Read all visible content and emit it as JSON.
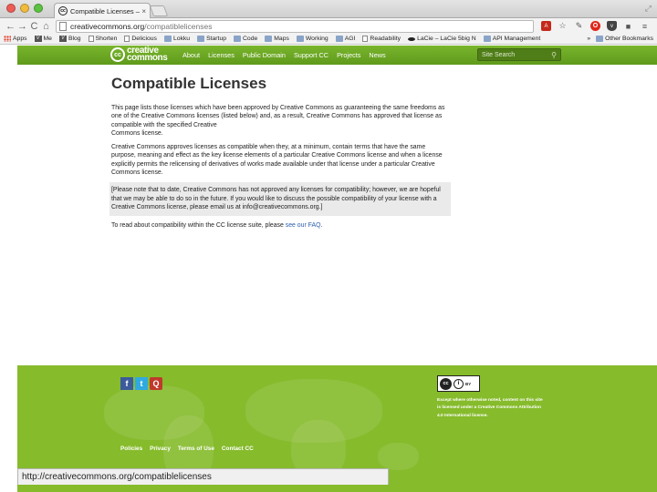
{
  "browser": {
    "tab": {
      "favicon": "cc-icon",
      "title": "Compatible Licenses – Cre",
      "close": "×"
    },
    "nav": {
      "back": "←",
      "forward": "→",
      "reload": "C",
      "home": "⌂"
    },
    "url": {
      "host": "creativecommons.org",
      "path": "/compatiblelicenses"
    },
    "toolbar_icons": [
      "pdf-icon",
      "star-icon",
      "wrench-icon",
      "opera-icon",
      "pocket-icon",
      "extension-icon",
      "menu-icon"
    ],
    "bookmarks": [
      {
        "label": "Apps",
        "icon": "apps-icon"
      },
      {
        "label": "Me",
        "icon": "v-icon"
      },
      {
        "label": "Blog",
        "icon": "v-icon"
      },
      {
        "label": "Shorten",
        "icon": "page-icon"
      },
      {
        "label": "Delicious",
        "icon": "page-icon"
      },
      {
        "label": "Lokku",
        "icon": "folder-icon"
      },
      {
        "label": "Startup",
        "icon": "folder-icon"
      },
      {
        "label": "Code",
        "icon": "folder-icon"
      },
      {
        "label": "Maps",
        "icon": "folder-icon"
      },
      {
        "label": "Working",
        "icon": "folder-icon"
      },
      {
        "label": "AGI",
        "icon": "folder-icon"
      },
      {
        "label": "Readability",
        "icon": "page-icon"
      },
      {
        "label": "LaCie – LaCie 5big N",
        "icon": "lacie-icon"
      },
      {
        "label": "API Management",
        "icon": "folder-icon"
      }
    ],
    "bookmarks_overflow": "»",
    "other_bookmarks": "Other Bookmarks",
    "status_url": "http://creativecommons.org/compatiblelicenses"
  },
  "site": {
    "logo": {
      "mark": "cc",
      "line1": "creative",
      "line2": "commons"
    },
    "nav": [
      "About",
      "Licenses",
      "Public Domain",
      "Support CC",
      "Projects",
      "News"
    ],
    "search_placeholder": "Site Search"
  },
  "content": {
    "title": "Compatible Licenses",
    "p1a": "This page lists those licenses which have been approved by Creative Commons as guaranteeing the same freedoms as one of the Creative Commons licenses (listed below) and, as a result, Creative Commons has approved that license as compatible with the specified Creative",
    "p1b": "Commons license.",
    "p2": "Creative Commons approves licenses as compatible when they, at a minimum, contain terms that have the same purpose, meaning and effect as the key license elements of a particular Creative Commons license and when a license explicitly permits the relicensing of derivatives of works made available under that license under a particular Creative Commons license.",
    "note": "[Please note that to date, Creative Commons has not approved any licenses for compatibility; however, we are hopeful that we may be able to do so in the future. If you would like to discuss the possible compatibility of your license with a Creative Commons license, please email us at info@creativecommons.org.]",
    "faq_prefix": "To read about compatibility within the CC license suite, please ",
    "faq_link": "see our FAQ",
    "faq_suffix": "."
  },
  "footer": {
    "social": [
      {
        "glyph": "f",
        "icon": "facebook-icon"
      },
      {
        "glyph": "t",
        "icon": "twitter-icon"
      },
      {
        "glyph": "Q",
        "icon": "question-icon"
      }
    ],
    "links": [
      "Policies",
      "Privacy",
      "Terms of Use",
      "Contact CC"
    ],
    "badge": {
      "cc": "cc",
      "by": "BY"
    },
    "license_text": "Except where otherwise noted, content on this site is licensed under a Creative Commons Attribution 4.0 International license.",
    "colors": {
      "header_green": "#6ea826",
      "footer_green": "#86bb2c",
      "link_blue": "#2a5db0"
    }
  }
}
